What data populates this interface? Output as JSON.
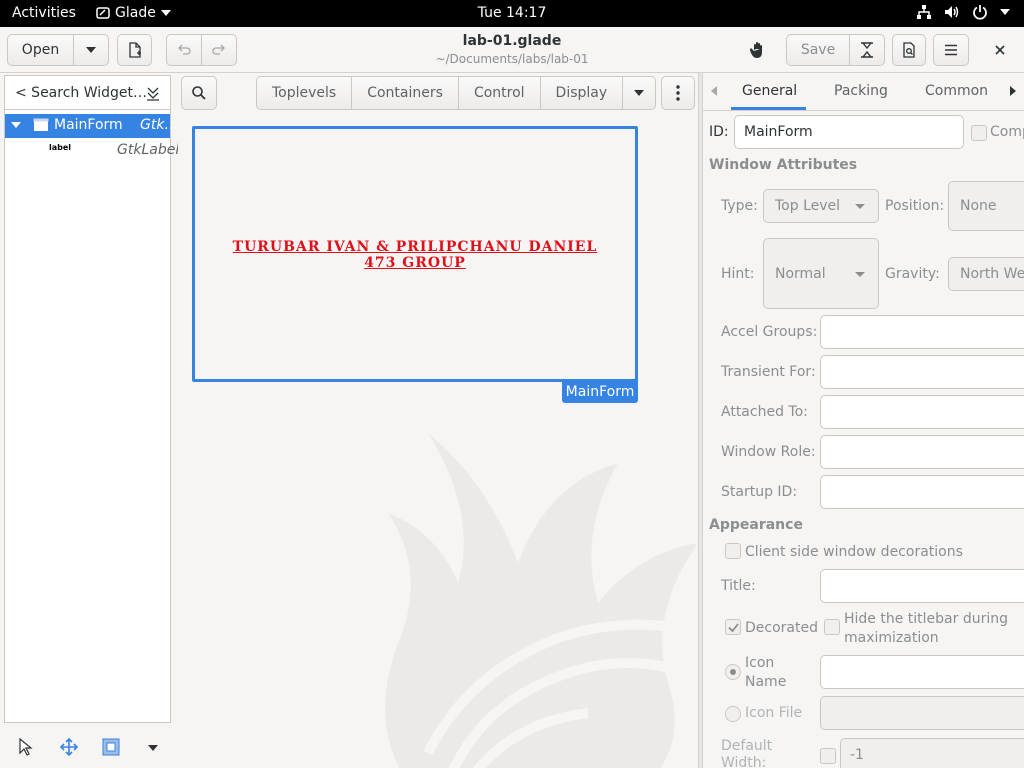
{
  "topbar": {
    "activities": "Activities",
    "app_name": "Glade",
    "clock": "Tue 14:17"
  },
  "header": {
    "open_label": "Open",
    "save_label": "Save",
    "title": "lab-01.glade",
    "subtitle": "~/Documents/labs/lab-01"
  },
  "left": {
    "search_placeholder": "< Search Widget…",
    "tree": [
      {
        "name": "MainForm",
        "type": "Gtk…",
        "selected": true
      },
      {
        "name": "label",
        "type": "GtkLabel"
      }
    ]
  },
  "palette": {
    "groups": [
      "Toplevels",
      "Containers",
      "Control",
      "Display"
    ]
  },
  "canvas": {
    "label_line1": "TURUBAR IVAN & PRILIPCHANU DANIEL",
    "label_line2": "473 GROUP",
    "form_tag": "MainForm"
  },
  "inspector": {
    "tabs": [
      "General",
      "Packing",
      "Common"
    ],
    "active_tab": "General",
    "id_label": "ID:",
    "id_value": "MainForm",
    "composite_label": "Comp",
    "section_window": "Window Attributes",
    "type_label": "Type:",
    "type_value": "Top Level",
    "position_label": "Position:",
    "position_value": "None",
    "hint_label": "Hint:",
    "hint_value": "Normal",
    "gravity_label": "Gravity:",
    "gravity_value": "North We",
    "accel_label": "Accel Groups:",
    "transient_label": "Transient For:",
    "attached_label": "Attached To:",
    "role_label": "Window Role:",
    "startup_label": "Startup ID:",
    "section_appearance": "Appearance",
    "csd_label": "Client side window decorations",
    "title_label": "Title:",
    "decorated_label": "Decorated",
    "hide_titlebar_label": "Hide the titlebar during maximization",
    "icon_name_label": "Icon Name",
    "icon_file_label": "Icon File",
    "default_width_label": "Default Width:",
    "default_width_value": "-1"
  },
  "colors": {
    "accent": "#3584e4",
    "label_red": "#e0101a"
  }
}
